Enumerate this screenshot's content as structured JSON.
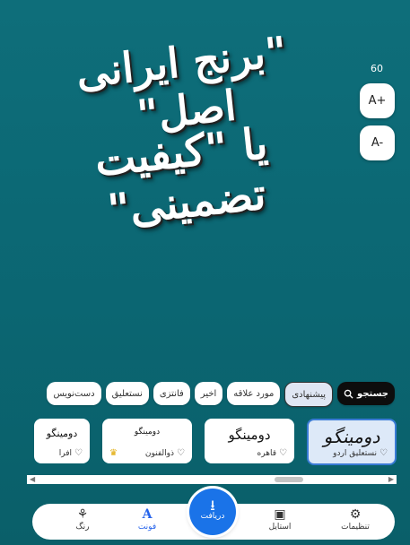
{
  "canvas": {
    "headline_line1": "\"برنج ایرانی اصل\"",
    "headline_line2": "یا \"کیفیت تضمینی\"",
    "text_size": "60",
    "increase_label": "A+",
    "decrease_label": "A-"
  },
  "font_filters": {
    "search_label": "جستجو",
    "chips": [
      "پیشنهادی",
      "مورد علاقه",
      "اخیر",
      "فانتزی",
      "نستعلیق",
      "دست‌نویس"
    ],
    "active_chip": "پیشنهادی"
  },
  "font_cards": [
    {
      "sample": "دومینگو",
      "name": "نستعلیق اردو",
      "selected": true
    },
    {
      "sample": "دومینگو",
      "name": "قاهره"
    },
    {
      "sample": "دومینگو",
      "name": "ذوالفنون",
      "premium": true
    },
    {
      "sample": "دومینگو",
      "name": "افرا"
    }
  ],
  "bottom_nav": {
    "settings": "تنظیمات",
    "style": "استایل",
    "download": "دریافت",
    "font": "فونت",
    "color": "رنگ"
  },
  "icons": {
    "search": "search-icon",
    "heart": "heart-icon",
    "crown": "crown-icon",
    "settings": "gear-icon",
    "style": "style-icon",
    "download": "download-icon",
    "font": "font-icon",
    "color": "palette-icon"
  },
  "colors": {
    "background": "#0b6672",
    "accent": "#1a73e8",
    "selected_card_border": "#3a7bd5"
  }
}
